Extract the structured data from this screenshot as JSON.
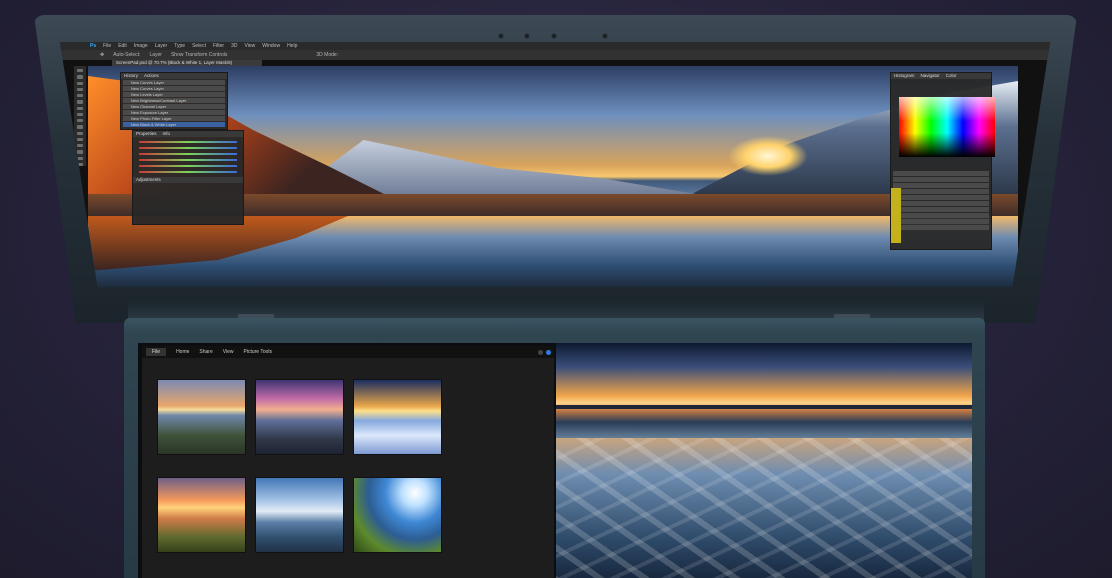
{
  "photoshop": {
    "menu": [
      "File",
      "Edit",
      "Image",
      "Layer",
      "Type",
      "Select",
      "Filter",
      "3D",
      "View",
      "Window",
      "Help"
    ],
    "options": [
      "Auto-Select:",
      "Layer",
      "Show Transform Controls",
      "3D Mode:"
    ],
    "document_tab": "ScreenPad.psd @ 70.7% (Black & White 1, Layer Mask/8)",
    "history_panel": {
      "tabs": [
        "History",
        "Actions"
      ],
      "items": [
        "New Curves Layer",
        "New Curves Layer",
        "New Levels Layer",
        "New Brightness/Contrast Layer",
        "New Channel Layer",
        "New Exposure Layer",
        "New Photo Filter Layer",
        "New Black & White Layer"
      ],
      "selected_index": 7
    },
    "properties_panel": {
      "tabs": [
        "Properties",
        "Info"
      ],
      "title": "Adjustments"
    },
    "right_panel": {
      "tabs": [
        "Histogram",
        "Navigator",
        "Color"
      ]
    }
  },
  "explorer": {
    "ribbon": {
      "file": "File",
      "tabs": [
        "Home",
        "Share",
        "View",
        "Picture Tools"
      ]
    }
  }
}
